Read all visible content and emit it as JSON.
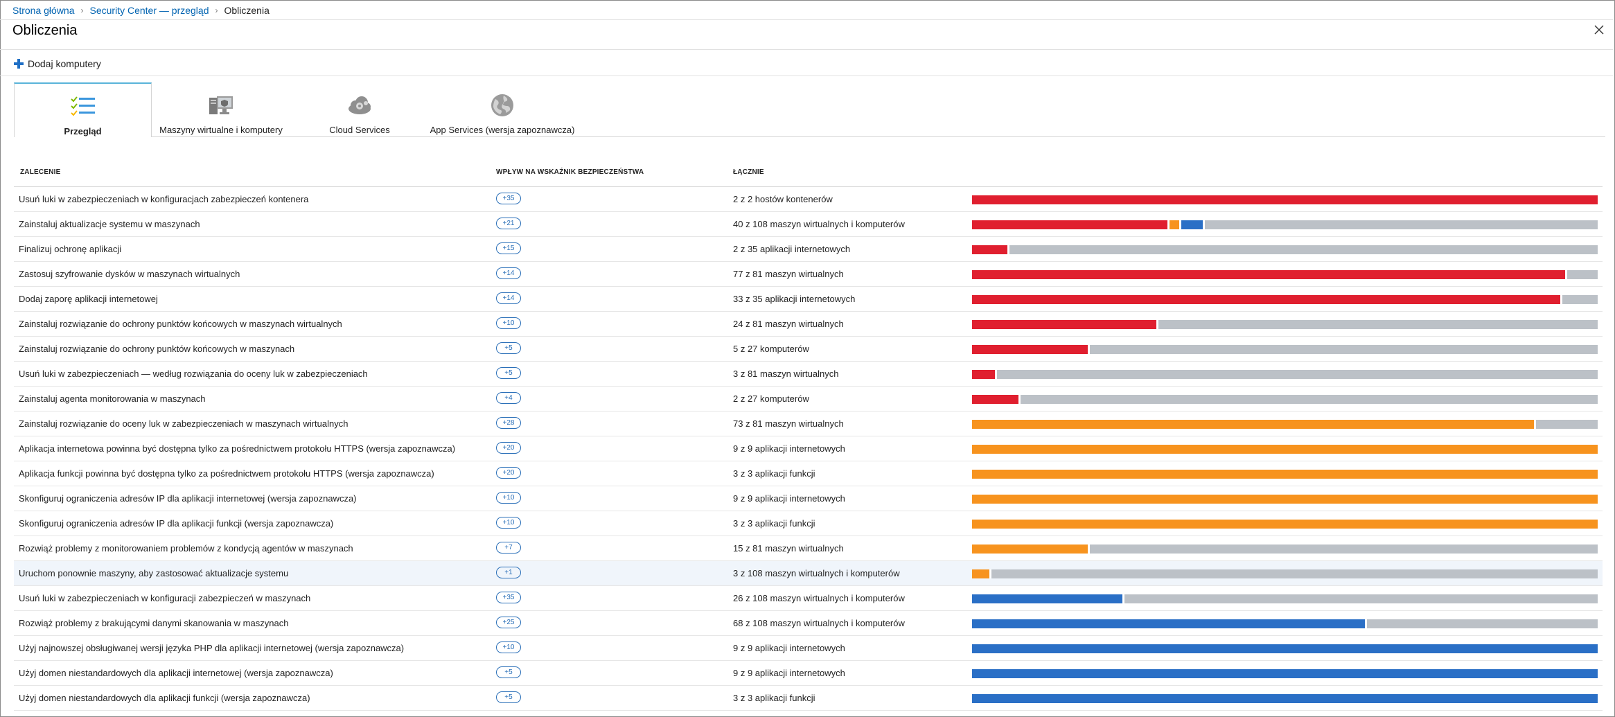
{
  "breadcrumb": {
    "home": "Strona główna",
    "security_center": "Security Center — przegląd",
    "current": "Obliczenia"
  },
  "page": {
    "title": "Obliczenia"
  },
  "toolbar": {
    "add_label": "Dodaj komputery"
  },
  "tabs": [
    {
      "label": "Przegląd",
      "icon": "checklist-icon",
      "active": true
    },
    {
      "label": "Maszyny wirtualne i komputery",
      "icon": "computer-icon",
      "active": false
    },
    {
      "label": "Cloud Services",
      "icon": "cloud-gear-icon",
      "active": false
    },
    {
      "label": "App Services (wersja zapoznawcza)",
      "icon": "globe-icon",
      "active": false
    }
  ],
  "table": {
    "headers": {
      "recommendation": "ZALECENIE",
      "impact": "WPŁYW NA WSKAŹNIK BEZPIECZEŃSTWA",
      "total": "ŁĄCZNIE"
    },
    "colors": {
      "high": "#e01f2f",
      "medium": "#f7931e",
      "low": "#2a6fc6",
      "healthy": "#bcc1c7"
    },
    "rows": [
      {
        "recommendation": "Usuń luki w zabezpieczeniach w konfiguracjach zabezpieczeń kontenera",
        "impact": "+35",
        "total": "2 z 2 hostów kontenerów",
        "bar": [
          {
            "c": "red",
            "f": 1.0
          }
        ]
      },
      {
        "recommendation": "Zainstaluj aktualizacje systemu w maszynach",
        "impact": "+21",
        "total": "40 z 108 maszyn wirtualnych i komputerów",
        "bar": [
          {
            "c": "red",
            "f": 0.315
          },
          {
            "c": "gap"
          },
          {
            "c": "orange",
            "f": 0.016
          },
          {
            "c": "gap"
          },
          {
            "c": "blue",
            "f": 0.035
          },
          {
            "c": "gap"
          },
          {
            "c": "gray",
            "f": 0.634
          }
        ]
      },
      {
        "recommendation": "Finalizuj ochronę aplikacji",
        "impact": "+15",
        "total": "2 z 35 aplikacji internetowych",
        "bar": [
          {
            "c": "red",
            "f": 0.057
          },
          {
            "c": "gap"
          },
          {
            "c": "gray",
            "f": 0.943
          }
        ]
      },
      {
        "recommendation": "Zastosuj szyfrowanie dysków w maszynach wirtualnych",
        "impact": "+14",
        "total": "77 z 81 maszyn wirtualnych",
        "bar": [
          {
            "c": "red",
            "f": 0.951
          },
          {
            "c": "gap"
          },
          {
            "c": "gray",
            "f": 0.049
          }
        ]
      },
      {
        "recommendation": "Dodaj zaporę aplikacji internetowej",
        "impact": "+14",
        "total": "33 z 35 aplikacji internetowych",
        "bar": [
          {
            "c": "red",
            "f": 0.943
          },
          {
            "c": "gap"
          },
          {
            "c": "gray",
            "f": 0.057
          }
        ]
      },
      {
        "recommendation": "Zainstaluj rozwiązanie do ochrony punktów końcowych w maszynach wirtualnych",
        "impact": "+10",
        "total": "24 z 81 maszyn wirtualnych",
        "bar": [
          {
            "c": "red",
            "f": 0.296
          },
          {
            "c": "gap"
          },
          {
            "c": "gray",
            "f": 0.704
          }
        ]
      },
      {
        "recommendation": "Zainstaluj rozwiązanie do ochrony punktów końcowych w maszynach",
        "impact": "+5",
        "total": "5 z 27 komputerów",
        "bar": [
          {
            "c": "red",
            "f": 0.185
          },
          {
            "c": "gap"
          },
          {
            "c": "gray",
            "f": 0.815
          }
        ]
      },
      {
        "recommendation": "Usuń luki w zabezpieczeniach — według rozwiązania do oceny luk w zabezpieczeniach",
        "impact": "+5",
        "total": "3 z 81 maszyn wirtualnych",
        "bar": [
          {
            "c": "red",
            "f": 0.037
          },
          {
            "c": "gap"
          },
          {
            "c": "gray",
            "f": 0.963
          }
        ]
      },
      {
        "recommendation": "Zainstaluj agenta monitorowania w maszynach",
        "impact": "+4",
        "total": "2 z 27 komputerów",
        "bar": [
          {
            "c": "red",
            "f": 0.074
          },
          {
            "c": "gap"
          },
          {
            "c": "gray",
            "f": 0.926
          }
        ]
      },
      {
        "recommendation": "Zainstaluj rozwiązanie do oceny luk w zabezpieczeniach w maszynach wirtualnych",
        "impact": "+28",
        "total": "73 z 81 maszyn wirtualnych",
        "bar": [
          {
            "c": "orange",
            "f": 0.901
          },
          {
            "c": "gap"
          },
          {
            "c": "gray",
            "f": 0.099
          }
        ]
      },
      {
        "recommendation": "Aplikacja internetowa powinna być dostępna tylko za pośrednictwem protokołu HTTPS (wersja zapoznawcza)",
        "impact": "+20",
        "total": "9 z 9 aplikacji internetowych",
        "bar": [
          {
            "c": "orange",
            "f": 1.0
          }
        ]
      },
      {
        "recommendation": "Aplikacja funkcji powinna być dostępna tylko za pośrednictwem protokołu HTTPS (wersja zapoznawcza)",
        "impact": "+20",
        "total": "3 z 3 aplikacji funkcji",
        "bar": [
          {
            "c": "orange",
            "f": 1.0
          }
        ]
      },
      {
        "recommendation": "Skonfiguruj ograniczenia adresów IP dla aplikacji internetowej (wersja zapoznawcza)",
        "impact": "+10",
        "total": "9 z 9 aplikacji internetowych",
        "bar": [
          {
            "c": "orange",
            "f": 1.0
          }
        ]
      },
      {
        "recommendation": "Skonfiguruj ograniczenia adresów IP dla aplikacji funkcji (wersja zapoznawcza)",
        "impact": "+10",
        "total": "3 z 3 aplikacji funkcji",
        "bar": [
          {
            "c": "orange",
            "f": 1.0
          }
        ]
      },
      {
        "recommendation": "Rozwiąż problemy z monitorowaniem problemów z kondycją agentów w maszynach",
        "impact": "+7",
        "total": "15 z 81 maszyn wirtualnych",
        "bar": [
          {
            "c": "orange",
            "f": 0.185
          },
          {
            "c": "gap"
          },
          {
            "c": "gray",
            "f": 0.815
          }
        ]
      },
      {
        "recommendation": "Uruchom ponownie maszyny, aby zastosować aktualizacje systemu",
        "impact": "+1",
        "total": "3 z 108 maszyn wirtualnych i komputerów",
        "bar": [
          {
            "c": "orange",
            "f": 0.028
          },
          {
            "c": "gap"
          },
          {
            "c": "gray",
            "f": 0.972
          }
        ],
        "highlighted": true
      },
      {
        "recommendation": "Usuń luki w zabezpieczeniach w konfiguracji zabezpieczeń w maszynach",
        "impact": "+35",
        "total": "26 z 108 maszyn wirtualnych i komputerów",
        "bar": [
          {
            "c": "blue",
            "f": 0.241
          },
          {
            "c": "gap"
          },
          {
            "c": "gray",
            "f": 0.759
          }
        ]
      },
      {
        "recommendation": "Rozwiąż problemy z brakującymi danymi skanowania w maszynach",
        "impact": "+25",
        "total": "68 z 108 maszyn wirtualnych i komputerów",
        "bar": [
          {
            "c": "blue",
            "f": 0.63
          },
          {
            "c": "gap"
          },
          {
            "c": "gray",
            "f": 0.37
          }
        ]
      },
      {
        "recommendation": "Użyj najnowszej obsługiwanej wersji języka PHP dla aplikacji internetowej (wersja zapoznawcza)",
        "impact": "+10",
        "total": "9 z 9 aplikacji internetowych",
        "bar": [
          {
            "c": "blue",
            "f": 1.0
          }
        ]
      },
      {
        "recommendation": "Użyj domen niestandardowych dla aplikacji internetowej (wersja zapoznawcza)",
        "impact": "+5",
        "total": "9 z 9 aplikacji internetowych",
        "bar": [
          {
            "c": "blue",
            "f": 1.0
          }
        ]
      },
      {
        "recommendation": "Użyj domen niestandardowych dla aplikacji funkcji (wersja zapoznawcza)",
        "impact": "+5",
        "total": "3 z 3 aplikacji funkcji",
        "bar": [
          {
            "c": "blue",
            "f": 1.0
          }
        ]
      }
    ]
  }
}
